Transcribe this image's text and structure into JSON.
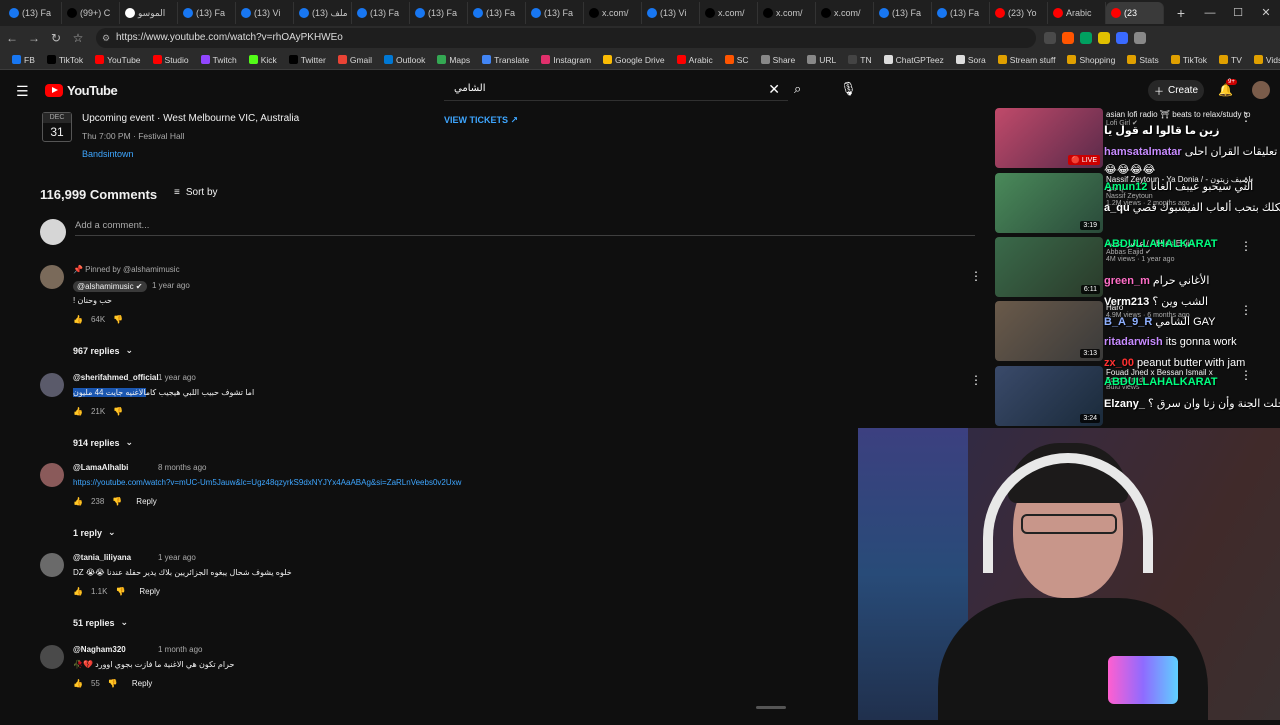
{
  "browser": {
    "tabs": [
      {
        "label": "(13) Fa",
        "color": "#1877f2"
      },
      {
        "label": "(99+) C",
        "color": "#000000"
      },
      {
        "label": "الموسو",
        "color": "#ffffff"
      },
      {
        "label": "(13) Fa",
        "color": "#1877f2"
      },
      {
        "label": "(13) Vi",
        "color": "#1877f2"
      },
      {
        "label": "(13) ملف",
        "color": "#1877f2"
      },
      {
        "label": "(13) Fa",
        "color": "#1877f2"
      },
      {
        "label": "(13) Fa",
        "color": "#1877f2"
      },
      {
        "label": "(13) Fa",
        "color": "#1877f2"
      },
      {
        "label": "(13) Fa",
        "color": "#1877f2"
      },
      {
        "label": "x.com/",
        "color": "#000000"
      },
      {
        "label": "(13) Vi",
        "color": "#1877f2"
      },
      {
        "label": "x.com/",
        "color": "#000000"
      },
      {
        "label": "x.com/",
        "color": "#000000"
      },
      {
        "label": "x.com/",
        "color": "#000000"
      },
      {
        "label": "(13) Fa",
        "color": "#1877f2"
      },
      {
        "label": "(13) Fa",
        "color": "#1877f2"
      },
      {
        "label": "(23) Yo",
        "color": "#ff0000"
      },
      {
        "label": "Arabic",
        "color": "#ff0000"
      },
      {
        "label": "(23",
        "color": "#ff0000",
        "active": true
      }
    ],
    "url": "https://www.youtube.com/watch?v=rhOAyPKHWEo",
    "bookmarks": [
      {
        "label": "FB",
        "color": "#1877f2"
      },
      {
        "label": "TikTok",
        "color": "#000000"
      },
      {
        "label": "YouTube",
        "color": "#ff0000"
      },
      {
        "label": "Studio",
        "color": "#ff0000"
      },
      {
        "label": "Twitch",
        "color": "#9146ff"
      },
      {
        "label": "Kick",
        "color": "#53fc18"
      },
      {
        "label": "Twitter",
        "color": "#000000"
      },
      {
        "label": "Gmail",
        "color": "#ea4335"
      },
      {
        "label": "Outlook",
        "color": "#0078d4"
      },
      {
        "label": "Maps",
        "color": "#34a853"
      },
      {
        "label": "Translate",
        "color": "#4285f4"
      },
      {
        "label": "Instagram",
        "color": "#e1306c"
      },
      {
        "label": "Google Drive",
        "color": "#fbbc04"
      },
      {
        "label": "Arabic",
        "color": "#ff0000"
      },
      {
        "label": "SC",
        "color": "#ff5500"
      },
      {
        "label": "Share",
        "color": "#888888"
      },
      {
        "label": "URL",
        "color": "#888888"
      },
      {
        "label": "TN",
        "color": "#444444"
      },
      {
        "label": "ChatGPTeez",
        "color": "#dddddd"
      },
      {
        "label": "Sora",
        "color": "#dddddd"
      },
      {
        "label": "Stream stuff",
        "color": "#e0a000"
      },
      {
        "label": "Shopping",
        "color": "#e0a000"
      },
      {
        "label": "Stats",
        "color": "#e0a000"
      },
      {
        "label": "TikTok",
        "color": "#e0a000"
      },
      {
        "label": "TV",
        "color": "#e0a000"
      },
      {
        "label": "Vids",
        "color": "#e0a000"
      }
    ]
  },
  "youtube": {
    "logo_text": "YouTube",
    "search_query": "الشامي",
    "create_label": "Create",
    "notif_badge": "9+"
  },
  "event": {
    "month": "DEC",
    "day": "31",
    "title": "Upcoming event · West Melbourne VIC, Australia",
    "subtitle": "Thu 7:00 PM · Festival Hall",
    "source": "Bandsintown",
    "tickets": "VIEW TICKETS ↗"
  },
  "comments_section": {
    "count": "116,999 Comments",
    "sort_label": "Sort by",
    "add_placeholder": "Add a comment..."
  },
  "comments": [
    {
      "pinned": "📌 Pinned by @alshamimusic",
      "author": "@alshamimusic ✔",
      "time": "1 year ago",
      "text": "حب وحنان !",
      "likes": "64K",
      "reply": "",
      "replies": "967 replies",
      "avatar": "#7a6a5a"
    },
    {
      "author": "@sherifahmed_official",
      "time": "1 year ago",
      "text_plain": "الاغنيه جايت 44 مليون ",
      "text_hl": "اما تشوف حبيب اللبي هيجيب كام",
      "likes": "21K",
      "reply": "",
      "replies": "914 replies",
      "avatar": "#5a5a6a"
    },
    {
      "author": "@LamaAlhalbi",
      "time": "8 months ago",
      "text": "https://youtube.com/watch?v=mUC-Um5Jauw&lc=Ugz48qzyrkS9dxNYJYx4AaABAg&si=ZaRLnVeebs0v2Uxw",
      "likes": "238",
      "reply": "Reply",
      "replies": "1 reply",
      "avatar": "#8a5a5a"
    },
    {
      "author": "@tania_liliyana",
      "time": "1 year ago",
      "text": "خلوه يشوف شحال يبغوه الجزائريين بلاك يدير حفلة عندنا 😭😭 DZ",
      "likes": "1.1K",
      "reply": "Reply",
      "replies": "51 replies",
      "avatar": "#6a6a6a"
    },
    {
      "author": "@Nagham320",
      "time": "1 month ago",
      "text": "حرام تكون هي الاغنية ما فازت بجوي اوورد 💔🥀",
      "likes": "55",
      "reply": "Reply",
      "replies": "",
      "avatar": "#4a4a4a"
    }
  ],
  "sidebar_videos": [
    {
      "title": "asian lofi radio ⛩ beats to relax/study to",
      "channel": "Lofi Girl ✔",
      "badge": "🔴 LIVE",
      "colors": [
        "#c04a6a",
        "#5a2a4a"
      ]
    },
    {
      "title": "Nassif Zeytoun - Ya Donia / ناصيف زيتون - يا دنيا",
      "channel": "Nassif Zeytoun",
      "stats": "1.2M views · 2 months ago",
      "badge": "3:19",
      "colors": [
        "#4a8a5a",
        "#2a4a3a"
      ]
    },
    {
      "title": "عباس عجيد / Abbas Eajid",
      "channel": "Abbas Eajid ✔",
      "stats": "4M views · 1 year ago",
      "badge": "6:11",
      "colors": [
        "#3a6a4a",
        "#2a3a2a"
      ]
    },
    {
      "title": "Haro",
      "channel": "",
      "stats": "4.9M views · 6 months ago",
      "badge": "3:13",
      "colors": [
        "#6a5a4a",
        "#3a3a3a"
      ]
    },
    {
      "title": "Fouad Jned x Bessan Ismail x",
      "channel": "Fouad Jned",
      "stats": "Bulu views",
      "badge": "3:24",
      "colors": [
        "#3a4a6a",
        "#1a2a3a"
      ]
    }
  ],
  "chat": [
    {
      "user": "زين ما قالوا له قول يا",
      "user_color": "#ffffff",
      "msg": ""
    },
    {
      "user": "hamsatalmatar",
      "user_color": "#c78bff",
      "msg": "تعليقات القران احلى"
    },
    {
      "user": "😂😂😂😂",
      "user_color": "#ffffff",
      "msg": ""
    },
    {
      "user": "Amun12",
      "user_color": "#00ff7f",
      "msg": "ألني سيحبو عيبف الغانا"
    },
    {
      "user": "a_qu",
      "user_color": "#ffffff",
      "msg": "شكلك بتحب ألعاب الفيسبوك قصي"
    },
    {
      "user": "ABDULLAHALKARAT",
      "user_color": "#00ff7f",
      "msg": ""
    },
    {
      "user": "green_m",
      "user_color": "#ff6ec7",
      "msg": "الأغاني حرام"
    },
    {
      "user": "Verm213",
      "user_color": "#ffffff",
      "msg": "الشب وين ؟"
    },
    {
      "user": "B_A_9_R",
      "user_color": "#8fb0ff",
      "msg": "الشامي GAY"
    },
    {
      "user": "ritadarwish",
      "user_color": "#c78bff",
      "msg": "its gonna work"
    },
    {
      "user": "zx_00",
      "user_color": "#ff3030",
      "msg": "peanut butter with jam"
    },
    {
      "user": "ABDULLAHALKARAT",
      "user_color": "#00ff7f",
      "msg": ""
    },
    {
      "user": "Elzany_",
      "user_color": "#ffffff",
      "msg": "دخلت الجنة وأن زنا وان سرق ؟"
    }
  ]
}
